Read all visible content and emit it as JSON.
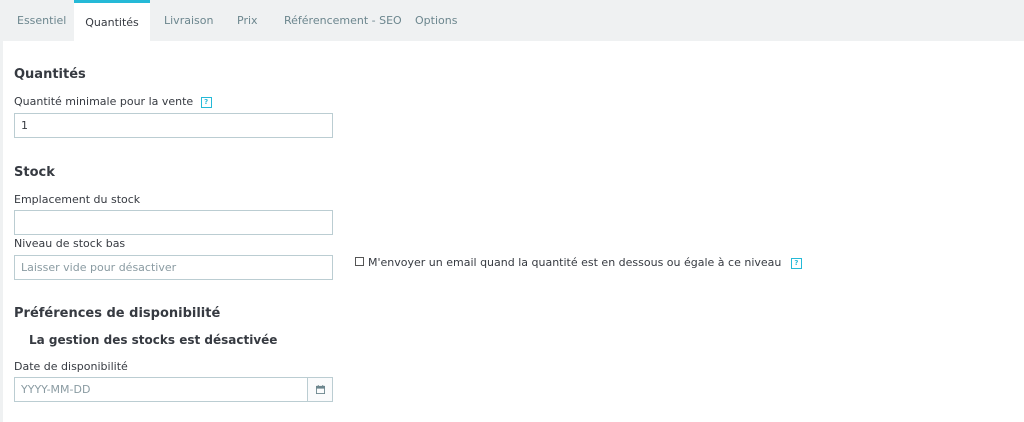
{
  "tabs": [
    {
      "label": "Essentiel"
    },
    {
      "label": "Quantités",
      "active": true
    },
    {
      "label": "Livraison"
    },
    {
      "label": "Prix"
    },
    {
      "label": "Référencement - SEO"
    },
    {
      "label": "Options"
    }
  ],
  "quantities": {
    "title": "Quantités",
    "min_qty_label": "Quantité minimale pour la vente",
    "min_qty_value": "1"
  },
  "stock": {
    "title": "Stock",
    "location_label": "Emplacement du stock",
    "location_value": "",
    "low_label": "Niveau de stock bas",
    "low_placeholder": "Laisser vide pour désactiver",
    "email_checkbox_label": "M'envoyer un email quand la quantité est en dessous ou égale à ce niveau",
    "email_checked": false
  },
  "availability": {
    "title": "Préférences de disponibilité",
    "subtitle": "La gestion des stocks est désactivée",
    "date_label": "Date de disponibilité",
    "date_placeholder": "YYYY-MM-DD"
  },
  "icons": {
    "help": "question-icon",
    "calendar": "calendar-icon"
  },
  "colors": {
    "accent": "#25b9d7",
    "tabbar_bg": "#eff1f2",
    "border": "#bbcdd2"
  }
}
